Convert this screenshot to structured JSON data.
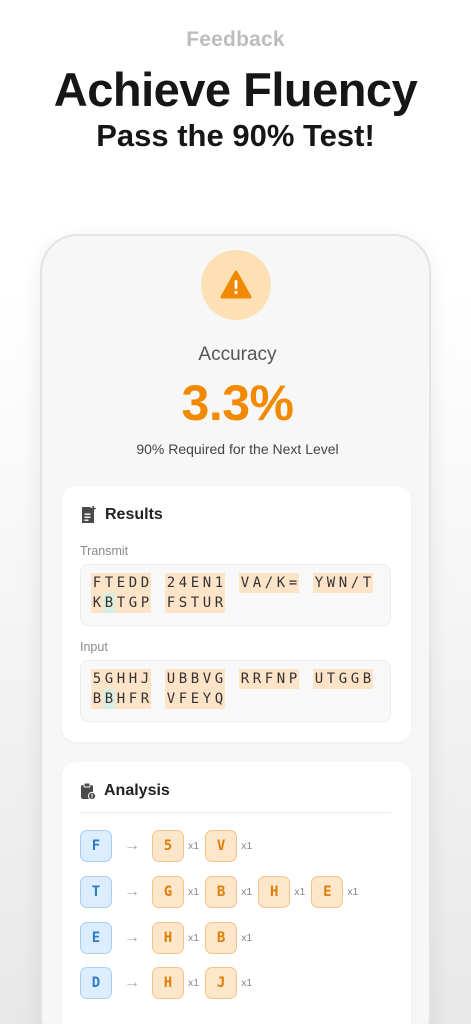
{
  "header": {
    "eyebrow": "Feedback",
    "title": "Achieve Fluency",
    "subtitle": "Pass the 90% Test!"
  },
  "score": {
    "label": "Accuracy",
    "value": "3.3%",
    "requirement": "90% Required for the Next Level",
    "icon": "warning-icon",
    "accent_color": "#f18a00"
  },
  "results": {
    "title": "Results",
    "transmit_label": "Transmit",
    "transmit_lines": [
      [
        "FTEDD",
        "24EN1",
        "VA/K=",
        "YWN/T"
      ],
      [
        "KBTGP",
        "FSTUR"
      ]
    ],
    "input_label": "Input",
    "input_lines": [
      [
        "5GHHJ",
        "UBBVG",
        "RRFNP",
        "UTGGB"
      ],
      [
        "BBHFR",
        "VFEYQ"
      ]
    ]
  },
  "analysis": {
    "title": "Analysis",
    "rows": [
      {
        "from": "F",
        "to": [
          {
            "ch": "5",
            "count": "x1"
          },
          {
            "ch": "V",
            "count": "x1"
          }
        ]
      },
      {
        "from": "T",
        "to": [
          {
            "ch": "G",
            "count": "x1"
          },
          {
            "ch": "B",
            "count": "x1"
          },
          {
            "ch": "H",
            "count": "x1"
          },
          {
            "ch": "E",
            "count": "x1"
          }
        ]
      },
      {
        "from": "E",
        "to": [
          {
            "ch": "H",
            "count": "x1"
          },
          {
            "ch": "B",
            "count": "x1"
          }
        ]
      },
      {
        "from": "D",
        "to": [
          {
            "ch": "H",
            "count": "x1"
          },
          {
            "ch": "J",
            "count": "x1"
          }
        ]
      }
    ]
  }
}
